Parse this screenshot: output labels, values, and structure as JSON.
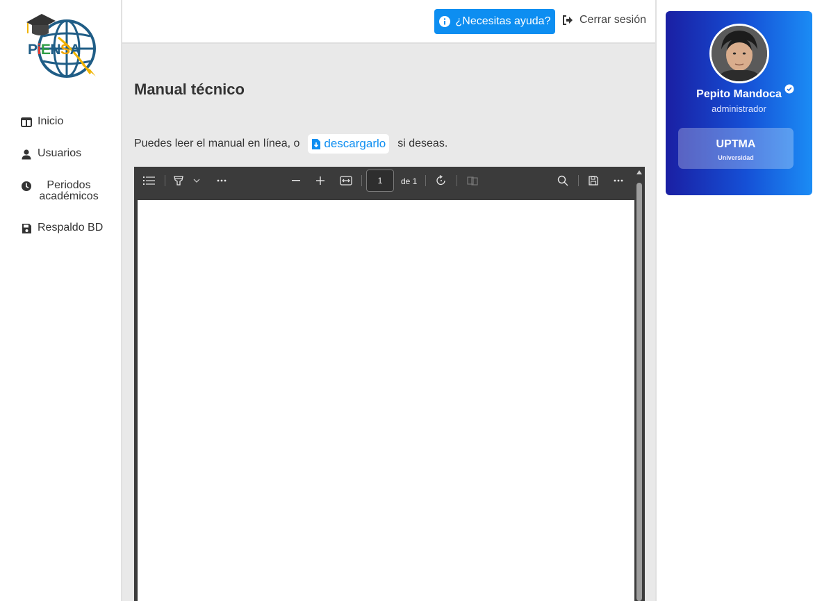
{
  "brand": {
    "logo_text": "PiENSA"
  },
  "sidebar": {
    "items": [
      {
        "label": "Inicio",
        "icon": "table-columns-icon"
      },
      {
        "label": "Usuarios",
        "icon": "user-icon"
      },
      {
        "label": "Periodos académicos",
        "icon": "clock-icon"
      },
      {
        "label": "Respaldo BD",
        "icon": "floppy-disk-icon"
      }
    ]
  },
  "header": {
    "help_label": "¿Necesitas ayuda?",
    "logout_label": "Cerrar sesión"
  },
  "main": {
    "title": "Manual técnico",
    "intro_before": "Puedes leer el manual en línea, o",
    "download_label": "descargarlo",
    "intro_after": "si deseas."
  },
  "pdf_viewer": {
    "page_value": "1",
    "page_of": "de 1"
  },
  "profile": {
    "name": "Pepito Mandoca",
    "role": "administrador",
    "institution": "UPTMA",
    "institution_type": "Universidad"
  },
  "colors": {
    "accent": "#0d8ef1",
    "card_gradient_start": "#1a1fa3",
    "card_gradient_end": "#1b8cf5"
  }
}
